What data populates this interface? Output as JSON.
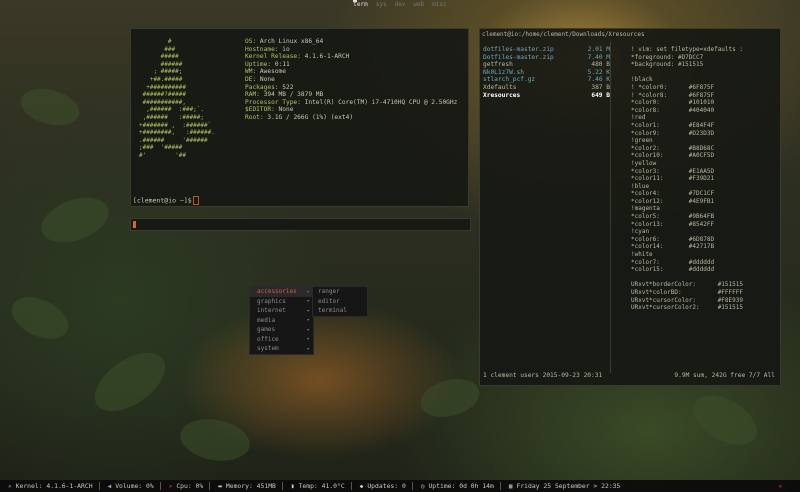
{
  "workspaces": [
    "term",
    "sys",
    "dev",
    "web",
    "misc"
  ],
  "active_workspace": "term",
  "neofetch": {
    "logo": "        #\n       ###\n      #####\n      ######\n    ; #####;\n   +##.#####\n  +##########\n ######?#####\n ###########,\n  ,######  :###;`.\n ,######   :#####;\n+####### ,  :######`\n+########,   :######.\n.######     '######\n;###  '#####\n#'        '##",
    "info": [
      {
        "key": "OS:",
        "value": "Arch Linux x86_64"
      },
      {
        "key": "Hostname:",
        "value": "io"
      },
      {
        "key": "Kernel Release:",
        "value": "4.1.6-1-ARCH"
      },
      {
        "key": "Uptime:",
        "value": "0:11"
      },
      {
        "key": "WM:",
        "value": "Awesome"
      },
      {
        "key": "DE:",
        "value": "None"
      },
      {
        "key": "Packages:",
        "value": "522"
      },
      {
        "key": "RAM:",
        "value": "394 MB / 3879 MB"
      },
      {
        "key": "Processor Type:",
        "value": "Intel(R) Core(TM) i7-4710HQ CPU @ 2.50GHz"
      },
      {
        "key": "$EDITOR:",
        "value": "None"
      },
      {
        "key": "Root:",
        "value": "3.1G / 266G (1%) (ext4)"
      }
    ],
    "prompt": "[clement@io ~]$"
  },
  "file_manager": {
    "path": "clement@io:/home/clement/Downloads/Xresources",
    "files": [
      {
        "name": "dotfiles-master.zip",
        "size": "2.01 M",
        "type": "dir"
      },
      {
        "name": "Dotfiles-master.zip",
        "size": "7.40 M",
        "type": "dir"
      },
      {
        "name": "getfresh",
        "size": "480 B",
        "type": "file"
      },
      {
        "name": "Nk0L1z7W.sh",
        "size": "5.22 K",
        "type": "dir"
      },
      {
        "name": "stlarch_pcf.gz",
        "size": "7.46 K",
        "type": "dir"
      },
      {
        "name": "Xdefaults",
        "size": "387 B",
        "type": "file"
      },
      {
        "name": "Xresources",
        "size": "649 B",
        "type": "selected"
      }
    ],
    "preview": [
      "! vim: set filetype=xdefaults :",
      "*foreground: #D7DCC7",
      "*background: #151515",
      "",
      "!black",
      "! *color0:      #6F875F",
      "! *color8:      #6F875F",
      "*color0:        #101010",
      "*color8:        #404040",
      "!red",
      "*color1:        #E84F4F",
      "*color9:        #D23D3D",
      "!green",
      "*color2:        #B8D68C",
      "*color10:       #A0CF5D",
      "!yellow",
      "*color3:        #E1AA5D",
      "*color11:       #F39D21",
      "!blue",
      "*color4:        #7DC1CF",
      "*color12:       #4E9FB1",
      "!magenta",
      "*color5:        #9B64FB",
      "*color13:       #8542FF",
      "!cyan",
      "*color6:        #6D878D",
      "*color14:       #42717B",
      "!white",
      "*color7:        #dddddd",
      "*color15:       #dddddd",
      "",
      "URxvt*borderColor:      #151515",
      "URxvt*colorBD:          #FFFFFF",
      "URxvt*cursorColor:      #F8E939",
      "URxvt*cursorColor2:     #151515"
    ],
    "status_left": "1 clement users 2015-09-23 20:31",
    "status_right": "9.9M sum, 242G free  7/7  All"
  },
  "app_menu": {
    "items": [
      {
        "label": "accessories",
        "active": true
      },
      {
        "label": "graphics",
        "active": false
      },
      {
        "label": "internet",
        "active": false
      },
      {
        "label": "media",
        "active": false
      },
      {
        "label": "games",
        "active": false
      },
      {
        "label": "office",
        "active": false
      },
      {
        "label": "system",
        "active": false
      }
    ],
    "submenu": [
      "ranger",
      "editor",
      "terminal"
    ]
  },
  "statusbar": {
    "kernel": "Kernel: 4.1.6-1-ARCH",
    "volume": "Volume: 0%",
    "cpu": "Cpu: 0%",
    "memory": "Memory: 451MB",
    "temp": "Temp: 41.0°C",
    "updates": "Updates: 0",
    "uptime": "Uptime: 0d 0h 14m",
    "datetime": "Friday 25 September > 22:35",
    "colors": {
      "accent_red": "#e05050",
      "icon_blue": "#8898d0"
    }
  }
}
